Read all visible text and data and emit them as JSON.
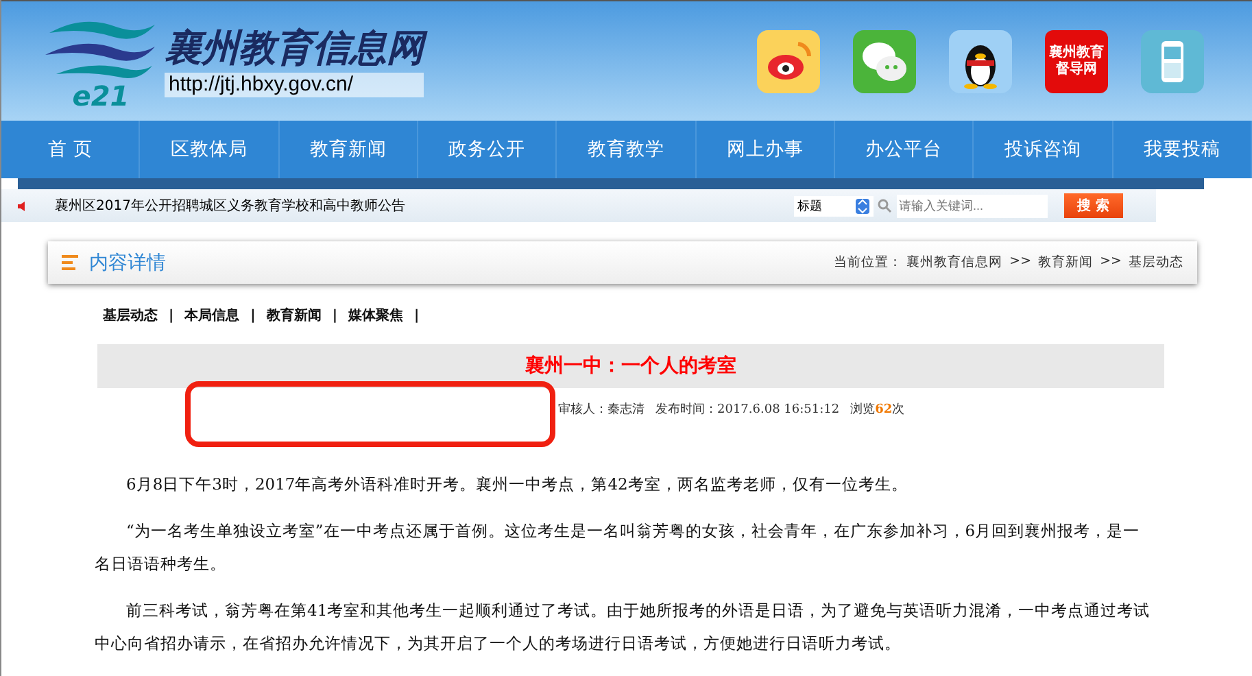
{
  "header": {
    "logo_text": "e21",
    "site_title": "襄州教育信息网",
    "url": "http://jtj.hbxy.gov.cn/",
    "social": [
      {
        "kind": "weibo"
      },
      {
        "kind": "wechat"
      },
      {
        "kind": "qq"
      },
      {
        "kind": "badge",
        "lines": [
          "襄州教育",
          "督导网"
        ]
      },
      {
        "kind": "phone"
      }
    ]
  },
  "nav": [
    {
      "label": "首 页"
    },
    {
      "label": "区教体局"
    },
    {
      "label": "教育新闻"
    },
    {
      "label": "政务公开"
    },
    {
      "label": "教育教学"
    },
    {
      "label": "网上办事"
    },
    {
      "label": "办公平台"
    },
    {
      "label": "投诉咨询"
    },
    {
      "label": "我要投稿"
    }
  ],
  "ticker": {
    "text": "襄州区2017年公开招聘城区义务教育学校和高中教师公告"
  },
  "search": {
    "scope": "标题",
    "placeholder": "请输入关键词...",
    "button": "搜 索"
  },
  "panel": {
    "title": "内容详情",
    "location_label": "当前位置：",
    "breadcrumb": [
      "襄州教育信息网",
      "教育新闻",
      "基层动态"
    ],
    "breadcrumb_sep": ">>"
  },
  "subnav": [
    "基层动态",
    "本局信息",
    "教育新闻",
    "媒体聚焦"
  ],
  "subnav_sep": "|",
  "article": {
    "title": "襄州一中：一个人的考室",
    "meta": {
      "reviewer": "审核人：秦志清",
      "published": "发布时间：2017.6.08 16:51:12",
      "views_prefix": "浏览",
      "views": "62",
      "views_suffix": "次"
    },
    "paragraphs": [
      "6月8日下午3时，2017年高考外语科准时开考。襄州一中考点，第42考室，两名监考老师，仅有一位考生。",
      "“为一名考生单独设立考室”在一中考点还属于首例。这位考生是一名叫翁芳粤的女孩，社会青年，在广东参加补习，6月回到襄州报考，是一名日语语种考生。",
      "前三科考试，翁芳粤在第41考室和其他考生一起顺利通过了考试。由于她所报考的外语是日语，为了避免与英语听力混淆，一中考点通过考试中心向省招办请示，在省招办允许情况下，为其开启了一个人的考场进行日语考试，方便她进行日语听力考试。"
    ]
  }
}
